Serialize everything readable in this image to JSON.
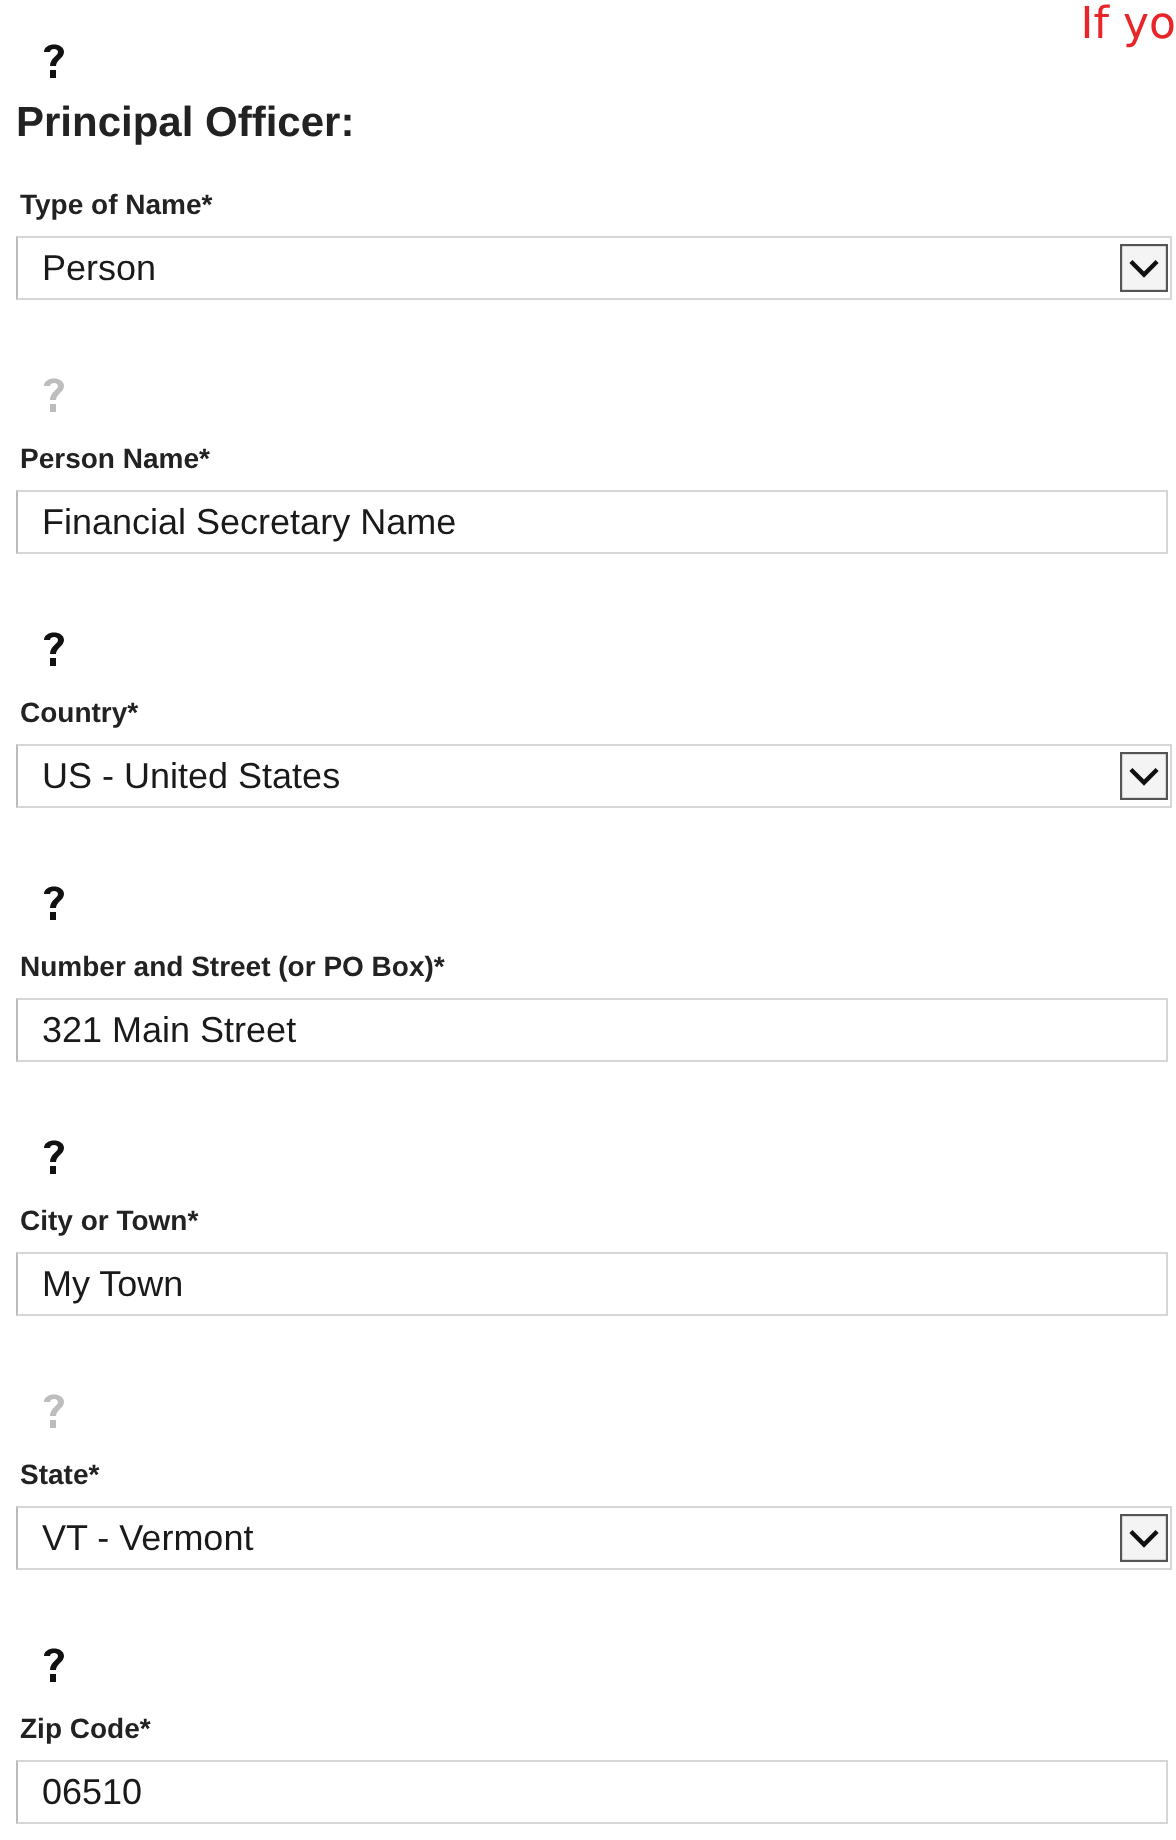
{
  "notice": "If yo",
  "heading_help": {
    "dimmed": false
  },
  "heading": "Principal Officer:",
  "fields": [
    {
      "kind": "select",
      "label": "Type of Name*",
      "value": "Person"
    },
    {
      "kind": "text",
      "label": "Person Name*",
      "value": "Financial Secretary Name",
      "help_dimmed": true
    },
    {
      "kind": "select",
      "label": "Country*",
      "value": "US - United States",
      "help_dimmed": false
    },
    {
      "kind": "text",
      "label": "Number and Street (or PO Box)*",
      "value": "321 Main Street",
      "help_dimmed": false
    },
    {
      "kind": "text",
      "label": "City or Town*",
      "value": "My Town",
      "help_dimmed": false
    },
    {
      "kind": "select",
      "label": "State*",
      "value": "VT - Vermont",
      "help_dimmed": true
    },
    {
      "kind": "text",
      "label": "Zip Code*",
      "value": "06510",
      "help_dimmed": false
    }
  ]
}
